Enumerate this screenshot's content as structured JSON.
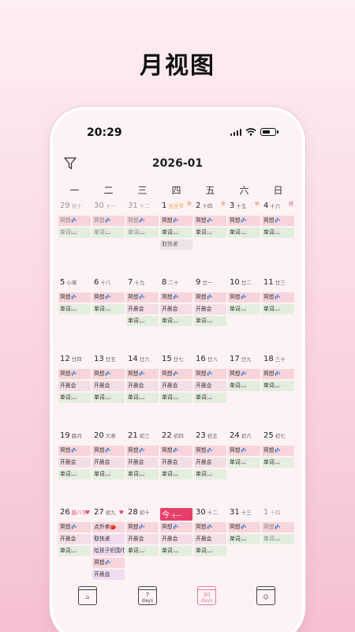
{
  "promo_title": "月视图",
  "status": {
    "time": "20:29"
  },
  "header": {
    "month": "2026-01"
  },
  "weekdays": [
    "一",
    "二",
    "三",
    "四",
    "五",
    "六",
    "日"
  ],
  "weeks": [
    [
      {
        "num": "29",
        "lunar": "初十",
        "dim": true,
        "events": [
          {
            "t": "冥想",
            "s": "💤",
            "c": "pink"
          },
          {
            "t": "单词",
            "s": "📖",
            "c": "green"
          }
        ]
      },
      {
        "num": "30",
        "lunar": "十一",
        "dim": true,
        "events": [
          {
            "t": "冥想",
            "s": "💤",
            "c": "pink"
          },
          {
            "t": "单词",
            "s": "📖",
            "c": "green"
          }
        ]
      },
      {
        "num": "31",
        "lunar": "十二",
        "dim": true,
        "events": [
          {
            "t": "冥想",
            "s": "💤",
            "c": "pink"
          },
          {
            "t": "单词",
            "s": "📖",
            "c": "green"
          }
        ]
      },
      {
        "num": "1",
        "lunar": "元旦节",
        "fest": true,
        "badge": "休",
        "events": [
          {
            "t": "冥想",
            "s": "💤",
            "c": "pink"
          },
          {
            "t": "单词",
            "s": "📖",
            "c": "green"
          },
          {
            "t": "取快递",
            "c": "grey"
          }
        ]
      },
      {
        "num": "2",
        "lunar": "十四",
        "badge": "休",
        "events": [
          {
            "t": "冥想",
            "s": "💤",
            "c": "pink"
          },
          {
            "t": "单词",
            "s": "📖",
            "c": "green"
          }
        ]
      },
      {
        "num": "3",
        "lunar": "十五",
        "badge": "休",
        "events": [
          {
            "t": "冥想",
            "s": "💤",
            "c": "pink"
          },
          {
            "t": "单词",
            "s": "📖",
            "c": "green"
          }
        ]
      },
      {
        "num": "4",
        "lunar": "十六",
        "badge": "班",
        "badgePink": true,
        "events": [
          {
            "t": "冥想",
            "s": "💤",
            "c": "pink"
          },
          {
            "t": "单词",
            "s": "📖",
            "c": "green"
          }
        ]
      }
    ],
    [
      {
        "num": "5",
        "lunar": "小寒",
        "events": [
          {
            "t": "冥想",
            "s": "💤",
            "c": "pink"
          },
          {
            "t": "单词",
            "s": "📖",
            "c": "green"
          }
        ]
      },
      {
        "num": "6",
        "lunar": "十八",
        "events": [
          {
            "t": "冥想",
            "s": "💤",
            "c": "pink"
          },
          {
            "t": "单词",
            "s": "📖",
            "c": "green"
          }
        ]
      },
      {
        "num": "7",
        "lunar": "十九",
        "events": [
          {
            "t": "冥想",
            "s": "💤",
            "c": "pink"
          },
          {
            "t": "开晨会",
            "c": "rose"
          },
          {
            "t": "单词",
            "s": "📖",
            "c": "green"
          }
        ]
      },
      {
        "num": "8",
        "lunar": "二十",
        "events": [
          {
            "t": "冥想",
            "s": "💤",
            "c": "pink"
          },
          {
            "t": "开晨会",
            "c": "rose"
          },
          {
            "t": "单词",
            "s": "📖",
            "c": "green"
          }
        ]
      },
      {
        "num": "9",
        "lunar": "廿一",
        "events": [
          {
            "t": "冥想",
            "s": "💤",
            "c": "pink"
          },
          {
            "t": "开晨会",
            "c": "rose"
          },
          {
            "t": "单词",
            "s": "📖",
            "c": "green"
          }
        ]
      },
      {
        "num": "10",
        "lunar": "廿二",
        "events": [
          {
            "t": "冥想",
            "s": "💤",
            "c": "pink"
          },
          {
            "t": "单词",
            "s": "📖",
            "c": "green"
          }
        ]
      },
      {
        "num": "11",
        "lunar": "廿三",
        "events": [
          {
            "t": "冥想",
            "s": "💤",
            "c": "pink"
          },
          {
            "t": "单词",
            "s": "📖",
            "c": "green"
          }
        ]
      }
    ],
    [
      {
        "num": "12",
        "lunar": "廿四",
        "events": [
          {
            "t": "冥想",
            "s": "💤",
            "c": "pink"
          },
          {
            "t": "开晨会",
            "c": "rose"
          },
          {
            "t": "单词",
            "s": "📖",
            "c": "green"
          }
        ]
      },
      {
        "num": "13",
        "lunar": "廿五",
        "events": [
          {
            "t": "冥想",
            "s": "💤",
            "c": "pink"
          },
          {
            "t": "开晨会",
            "c": "rose"
          },
          {
            "t": "单词",
            "s": "📖",
            "c": "green"
          }
        ]
      },
      {
        "num": "14",
        "lunar": "廿六",
        "events": [
          {
            "t": "冥想",
            "s": "💤",
            "c": "pink"
          },
          {
            "t": "开晨会",
            "c": "rose"
          },
          {
            "t": "单词",
            "s": "📖",
            "c": "green"
          }
        ]
      },
      {
        "num": "15",
        "lunar": "廿七",
        "events": [
          {
            "t": "冥想",
            "s": "💤",
            "c": "pink"
          },
          {
            "t": "开晨会",
            "c": "rose"
          },
          {
            "t": "单词",
            "s": "📖",
            "c": "green"
          }
        ]
      },
      {
        "num": "16",
        "lunar": "廿八",
        "events": [
          {
            "t": "冥想",
            "s": "💤",
            "c": "pink"
          },
          {
            "t": "开晨会",
            "c": "rose"
          },
          {
            "t": "单词",
            "s": "📖",
            "c": "green"
          }
        ]
      },
      {
        "num": "17",
        "lunar": "廿九",
        "events": [
          {
            "t": "冥想",
            "s": "💤",
            "c": "pink"
          },
          {
            "t": "单词",
            "s": "📖",
            "c": "green"
          }
        ]
      },
      {
        "num": "18",
        "lunar": "三十",
        "events": [
          {
            "t": "冥想",
            "s": "💤",
            "c": "pink"
          },
          {
            "t": "单词",
            "s": "📖",
            "c": "green"
          }
        ]
      }
    ],
    [
      {
        "num": "19",
        "lunar": "腊月",
        "events": [
          {
            "t": "冥想",
            "s": "💤",
            "c": "pink"
          },
          {
            "t": "开晨会",
            "c": "rose"
          },
          {
            "t": "单词",
            "s": "📖",
            "c": "green"
          }
        ]
      },
      {
        "num": "20",
        "lunar": "大寒",
        "events": [
          {
            "t": "冥想",
            "s": "💤",
            "c": "pink"
          },
          {
            "t": "开晨会",
            "c": "rose"
          },
          {
            "t": "单词",
            "s": "📖",
            "c": "green"
          }
        ]
      },
      {
        "num": "21",
        "lunar": "初三",
        "events": [
          {
            "t": "冥想",
            "s": "💤",
            "c": "pink"
          },
          {
            "t": "开晨会",
            "c": "rose"
          },
          {
            "t": "单词",
            "s": "📖",
            "c": "green"
          }
        ]
      },
      {
        "num": "22",
        "lunar": "初四",
        "events": [
          {
            "t": "冥想",
            "s": "💤",
            "c": "pink"
          },
          {
            "t": "开晨会",
            "c": "rose"
          },
          {
            "t": "单词",
            "s": "📖",
            "c": "green"
          }
        ]
      },
      {
        "num": "23",
        "lunar": "初五",
        "events": [
          {
            "t": "冥想",
            "s": "💤",
            "c": "pink"
          },
          {
            "t": "开晨会",
            "c": "rose"
          },
          {
            "t": "单词",
            "s": "📖",
            "c": "green"
          }
        ]
      },
      {
        "num": "24",
        "lunar": "初六",
        "events": [
          {
            "t": "冥想",
            "s": "💤",
            "c": "pink"
          },
          {
            "t": "单词",
            "s": "📖",
            "c": "green"
          }
        ]
      },
      {
        "num": "25",
        "lunar": "初七",
        "events": [
          {
            "t": "冥想",
            "s": "💤",
            "c": "pink"
          },
          {
            "t": "单词",
            "s": "📖",
            "c": "green"
          }
        ]
      }
    ],
    [
      {
        "num": "26",
        "lunar": "腊八节",
        "festPink": true,
        "heart": "♥",
        "events": [
          {
            "t": "冥想",
            "s": "💤",
            "c": "pink"
          },
          {
            "t": "开晨会",
            "c": "rose"
          },
          {
            "t": "单词",
            "s": "📖",
            "c": "green"
          }
        ]
      },
      {
        "num": "27",
        "lunar": "初九",
        "heart": "♥",
        "events": [
          {
            "t": "点外卖",
            "s": "🍅",
            "c": "pink"
          },
          {
            "t": "取快递",
            "c": "lilac"
          },
          {
            "t": "给孩子织围巾",
            "c": "lilac"
          },
          {
            "t": "冥想",
            "s": "💤",
            "c": "pink"
          },
          {
            "t": "开晨会",
            "c": "lilac"
          }
        ]
      },
      {
        "num": "28",
        "lunar": "初十",
        "events": [
          {
            "t": "冥想",
            "s": "💤",
            "c": "pink"
          },
          {
            "t": "开晨会",
            "c": "rose"
          },
          {
            "t": "单词",
            "s": "📖",
            "c": "green"
          }
        ]
      },
      {
        "num": "今",
        "lunar": "十一",
        "today": true,
        "events": [
          {
            "t": "冥想",
            "s": "💤",
            "c": "pink"
          },
          {
            "t": "开晨会",
            "c": "rose"
          },
          {
            "t": "单词",
            "s": "📖",
            "c": "green"
          }
        ]
      },
      {
        "num": "30",
        "lunar": "十二",
        "events": [
          {
            "t": "冥想",
            "s": "💤",
            "c": "pink"
          },
          {
            "t": "开晨会",
            "c": "rose"
          },
          {
            "t": "单词",
            "s": "📖",
            "c": "green"
          }
        ]
      },
      {
        "num": "31",
        "lunar": "十三",
        "events": [
          {
            "t": "冥想",
            "s": "💤",
            "c": "pink"
          },
          {
            "t": "单词",
            "s": "📖",
            "c": "green"
          }
        ]
      },
      {
        "num": "1",
        "lunar": "十四",
        "dim": true,
        "events": [
          {
            "t": "冥想",
            "s": "💤",
            "c": "pink"
          },
          {
            "t": "单词",
            "s": "📖",
            "c": "green"
          }
        ]
      }
    ]
  ],
  "tabs": [
    {
      "n": "⌂",
      "u": "",
      "icon": "home-icon"
    },
    {
      "n": "7",
      "u": "days",
      "icon": "week-calendar-icon"
    },
    {
      "n": "30",
      "u": "days",
      "icon": "month-calendar-icon",
      "active": true
    },
    {
      "n": "☺",
      "u": "",
      "icon": "profile-icon"
    }
  ],
  "colors": {
    "accent": "#e83e6c",
    "event_pink": "#f7d5db",
    "event_green": "#e3eedf",
    "event_lilac": "#f1dbef"
  }
}
